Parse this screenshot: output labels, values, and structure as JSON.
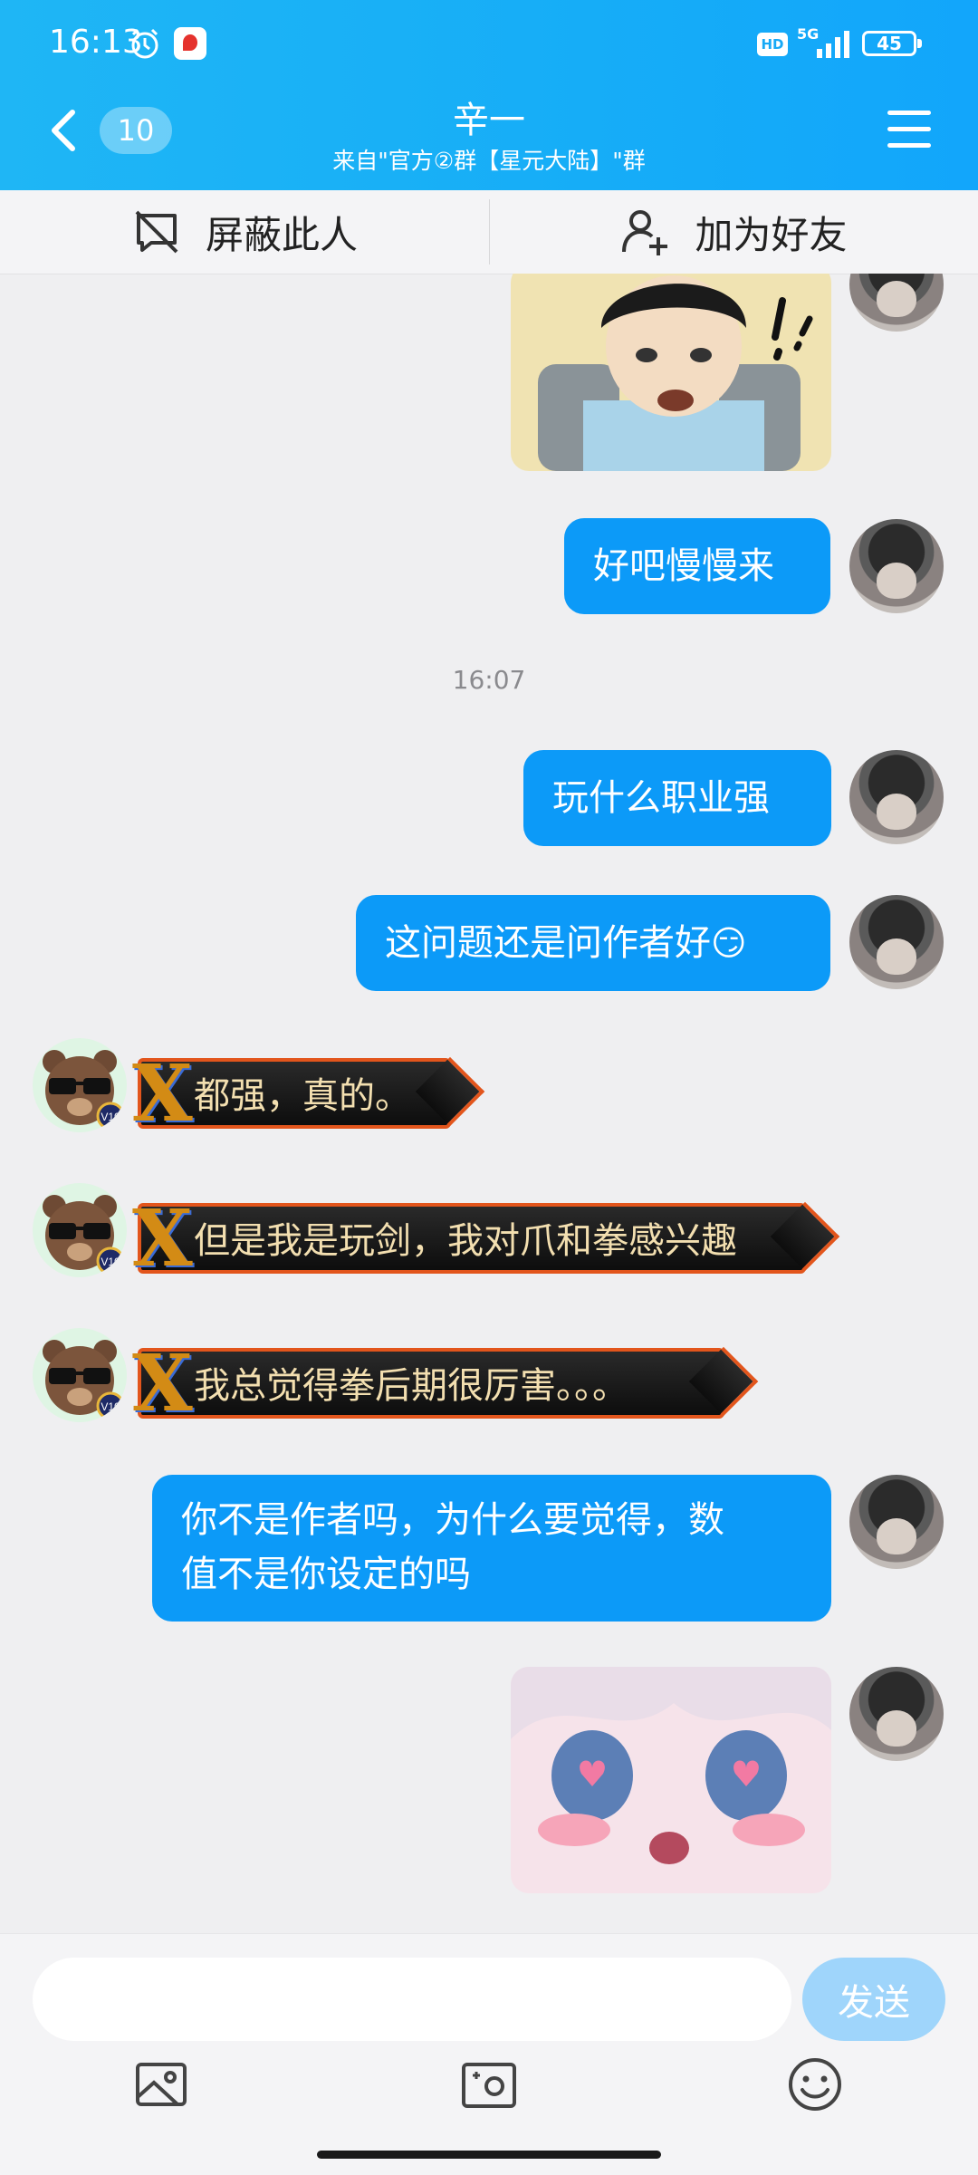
{
  "status_bar": {
    "time": "16:13",
    "network": "5G",
    "hd": "HD",
    "battery": "45"
  },
  "header": {
    "title": "辛一",
    "subtitle": "来自\"官方②群【星元大陆】\"群",
    "unread_badge": "10"
  },
  "actions": {
    "block_label": "屏蔽此人",
    "add_friend_label": "加为好友"
  },
  "messages": {
    "m1": "好吧慢慢来",
    "time_divider": "16:07",
    "m2": "玩什么职业强",
    "m3": "这问题还是问作者好",
    "m3_emoji": "😏",
    "t1": "都强，真的。",
    "t2": "但是我是玩剑，我对爪和拳感兴趣",
    "t3": "我总觉得拳后期很厉害。。。",
    "m4_line1": "你不是作者吗，为什么要觉得，数",
    "m4_line2": "值不是你设定的吗"
  },
  "composer": {
    "send_label": "发送",
    "placeholder": ""
  },
  "icons": [
    "back-icon",
    "menu-icon",
    "block-user-icon",
    "add-friend-icon",
    "image-icon",
    "camera-icon",
    "emoji-icon"
  ],
  "colors": {
    "header": "#16adf7",
    "bubble_me": "#0c9af8",
    "send_button": "#9fd5fb",
    "bubble_them_border": "#e2551c"
  }
}
